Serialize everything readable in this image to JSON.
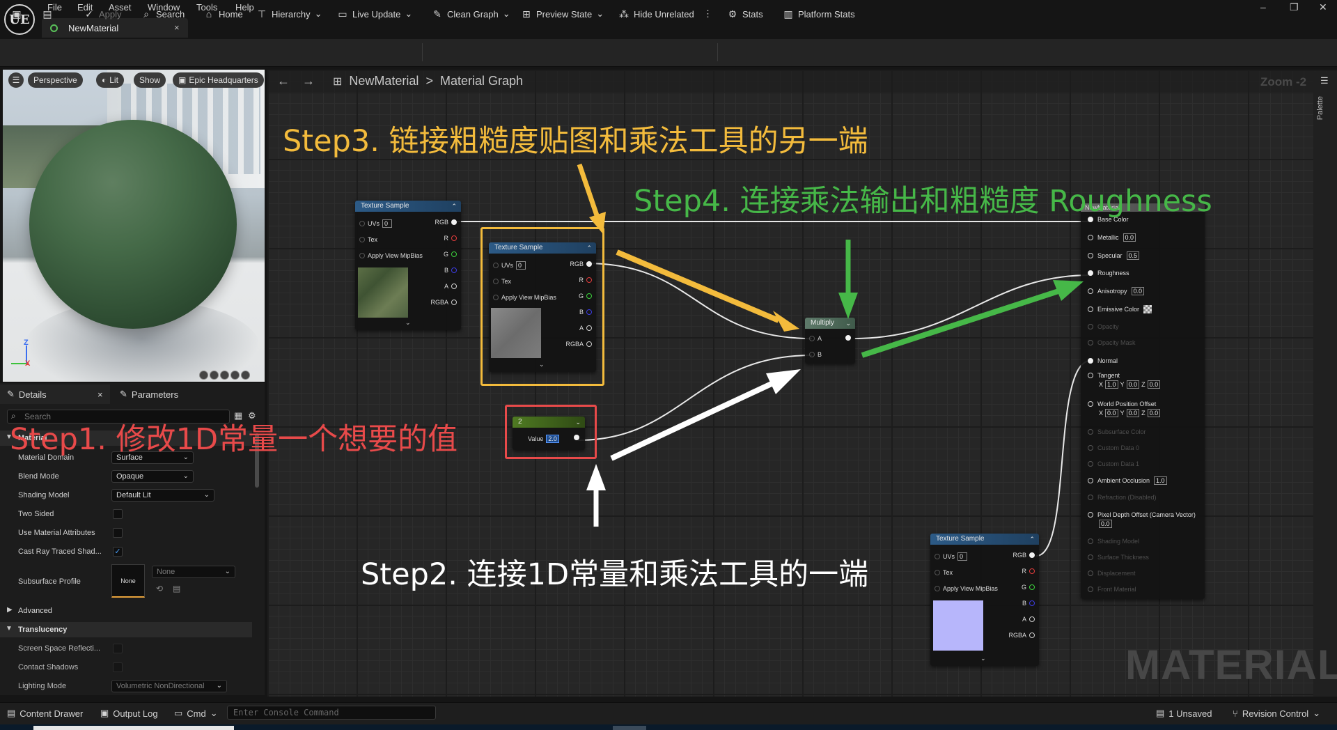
{
  "app": {
    "logo": "UE",
    "menu": [
      "File",
      "Edit",
      "Asset",
      "Window",
      "Tools",
      "Help"
    ],
    "tab_title": "NewMaterial",
    "tab_close": "×",
    "window_controls": [
      "–",
      "❐",
      "✕"
    ]
  },
  "toolbar": {
    "apply": "Apply",
    "search": "Search",
    "home": "Home",
    "hierarchy": "Hierarchy",
    "live_update": "Live Update",
    "clean_graph": "Clean Graph",
    "preview_state": "Preview State",
    "hide_unrelated": "Hide Unrelated",
    "more": "⋮",
    "stats": "Stats",
    "platform_stats": "Platform Stats"
  },
  "viewport": {
    "perspective": "Perspective",
    "lit": "Lit",
    "show": "Show",
    "environment": "Epic Headquarters",
    "axis_z": "Z",
    "axis_x": "X"
  },
  "details": {
    "tab_details": "Details",
    "tab_close": "×",
    "tab_parameters": "Parameters",
    "search_placeholder": "Search",
    "category_material": "Material",
    "props": [
      {
        "label": "Material Domain",
        "value": "Surface"
      },
      {
        "label": "Blend Mode",
        "value": "Opaque"
      },
      {
        "label": "Shading Model",
        "value": "Default Lit"
      }
    ],
    "two_sided": "Two Sided",
    "use_material_attributes": "Use Material Attributes",
    "cast_ray_traced": "Cast Ray Traced Shad...",
    "subsurface_profile": "Subsurface Profile",
    "subsurface_none_thumb": "None",
    "subsurface_none_dropdown": "None",
    "advanced": "Advanced",
    "category_translucency": "Translucency",
    "screen_space_reflections": "Screen Space Reflecti...",
    "contact_shadows": "Contact Shadows",
    "lighting_mode": "Lighting Mode",
    "lighting_mode_value": "Volumetric NonDirectional"
  },
  "graph": {
    "breadcrumb_root": "NewMaterial",
    "breadcrumb_sep": ">",
    "breadcrumb_leaf": "Material Graph",
    "zoom": "Zoom -2",
    "watermark": "MATERIAL",
    "palette": "Palette"
  },
  "nodes": {
    "texture_sample_title": "Texture Sample",
    "uvs": "UVs",
    "uvs_val": "0",
    "tex": "Tex",
    "apply_view_mipbias": "Apply View MipBias",
    "rgb": "RGB",
    "r": "R",
    "g": "G",
    "b": "B",
    "a": "A",
    "rgba": "RGBA",
    "multiply_title": "Multiply",
    "multiply_a": "A",
    "multiply_b": "B",
    "constant_title": "2",
    "constant_value_label": "Value",
    "constant_value": "2.0",
    "output_title": "NewMaterial",
    "outputs": {
      "base_color": "Base Color",
      "metallic": "Metallic",
      "metallic_v": "0.0",
      "specular": "Specular",
      "specular_v": "0.5",
      "roughness": "Roughness",
      "anisotropy": "Anisotropy",
      "anisotropy_v": "0.0",
      "emissive_color": "Emissive Color",
      "opacity": "Opacity",
      "opacity_mask": "Opacity Mask",
      "normal": "Normal",
      "tangent": "Tangent",
      "tangent_x": "1.0",
      "tangent_y": "0.0",
      "tangent_z": "0.0",
      "world_position_offset": "World Position Offset",
      "wpo_x": "0.0",
      "wpo_y": "0.0",
      "wpo_z": "0.0",
      "subsurface_color": "Subsurface Color",
      "custom_data_0": "Custom Data 0",
      "custom_data_1": "Custom Data 1",
      "ambient_occlusion": "Ambient Occlusion",
      "ambient_occlusion_v": "1.0",
      "refraction": "Refraction (Disabled)",
      "pixel_depth_offset": "Pixel Depth Offset (Camera Vector)",
      "pixel_depth_offset_v": "0.0",
      "shading_model": "Shading Model",
      "surface_thickness": "Surface Thickness",
      "displacement": "Displacement",
      "front_material": "Front Material",
      "x": "X",
      "y": "Y",
      "z": "Z"
    }
  },
  "annotations": {
    "step1": "Step1. 修改1D常量一个想要的值",
    "step2": "Step2. 连接1D常量和乘法工具的一端",
    "step3": "Step3. 链接粗糙度贴图和乘法工具的另一端",
    "step4": "Step4. 连接乘法输出和粗糙度 Roughness",
    "colors": {
      "step1": "#e84a4a",
      "step2": "#ffffff",
      "step3": "#f3bb3c",
      "step4": "#46b848"
    }
  },
  "statusbar": {
    "content_drawer": "Content Drawer",
    "output_log": "Output Log",
    "cmd": "Cmd",
    "console_placeholder": "Enter Console Command",
    "unsaved": "1 Unsaved",
    "revision_control": "Revision Control"
  }
}
